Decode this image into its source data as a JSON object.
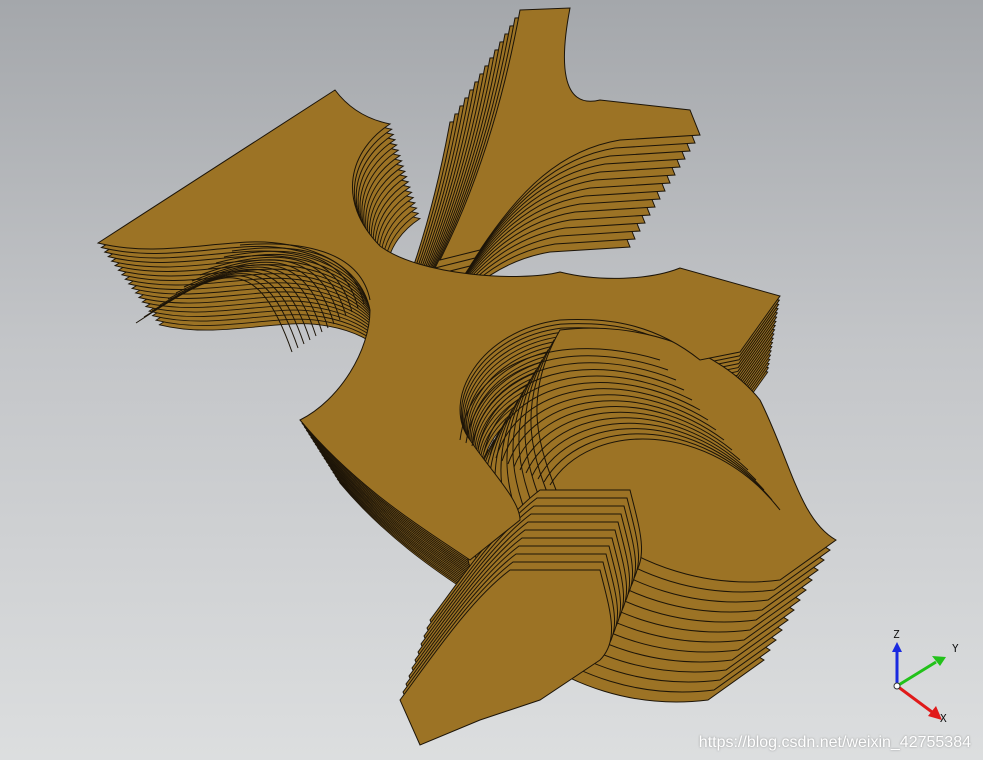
{
  "viewport": {
    "model_color": "#9c7325",
    "edge_color": "#1c1408",
    "background_top": "#a4a7ab",
    "background_bottom": "#dcdedf",
    "model_description": "sliced-layers-solid"
  },
  "triad": {
    "x_label": "X",
    "y_label": "Y",
    "z_label": "Z",
    "x_color": "#e01a1a",
    "y_color": "#22c21a",
    "z_color": "#1a2ae0"
  },
  "watermark": {
    "text": "https://blog.csdn.net/weixin_42755384"
  }
}
